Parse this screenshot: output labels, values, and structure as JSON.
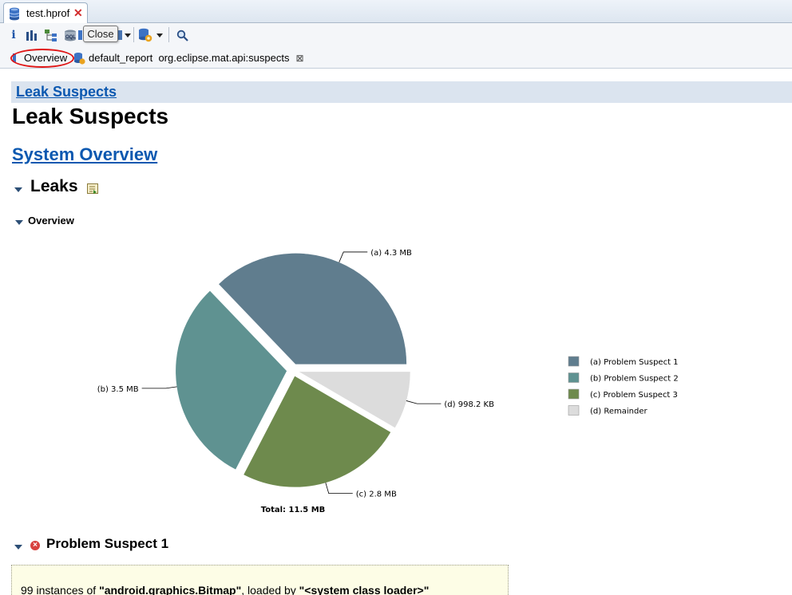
{
  "editor_tab": {
    "title": "test.hprof"
  },
  "toolbar": {
    "tooltip": "Close",
    "icons": [
      "info-icon",
      "histogram-icon",
      "dominator-tree-icon",
      "oql-icon",
      "query-browser-icon",
      "dropdown-icon",
      "heap-dump-icon",
      "dropdown-icon",
      "search-icon"
    ]
  },
  "subtabs": [
    {
      "label": "Overview"
    },
    {
      "label": "default_report  org.eclipse.mat.api:suspects"
    }
  ],
  "breadcrumb": "Leak Suspects",
  "page_title": "Leak Suspects",
  "system_overview_link": "System Overview",
  "leaks_heading": "Leaks",
  "overview_heading": "Overview",
  "chart_data": {
    "type": "pie",
    "unit": "MB",
    "labels": [
      "(a)  4.3 MB",
      "(b)  3.5 MB",
      "(c)  2.8 MB",
      "(d)  998.2 KB"
    ],
    "values": [
      4.3,
      3.5,
      2.8,
      0.9748
    ],
    "legend": [
      "(a)  Problem Suspect 1",
      "(b)  Problem Suspect 2",
      "(c)  Problem Suspect 3",
      "(d)  Remainder"
    ],
    "colors": [
      "#607d8e",
      "#5f9291",
      "#6e8a4d",
      "#dcdcdc"
    ],
    "total": "Total: 11.5 MB",
    "legend_placement": "right"
  },
  "problem_suspect": {
    "heading": "Problem Suspect 1",
    "count_text": "99 instances of ",
    "class_name": "\"android.graphics.Bitmap\"",
    "loaded_by": ", loaded by ",
    "loader": "\"<system class loader>\""
  },
  "colors": {
    "link": "#0b58b0",
    "breadcrumb_bg": "#dbe4ef",
    "highlight": "#e01616",
    "suspect_bg": "#fdfde6"
  }
}
